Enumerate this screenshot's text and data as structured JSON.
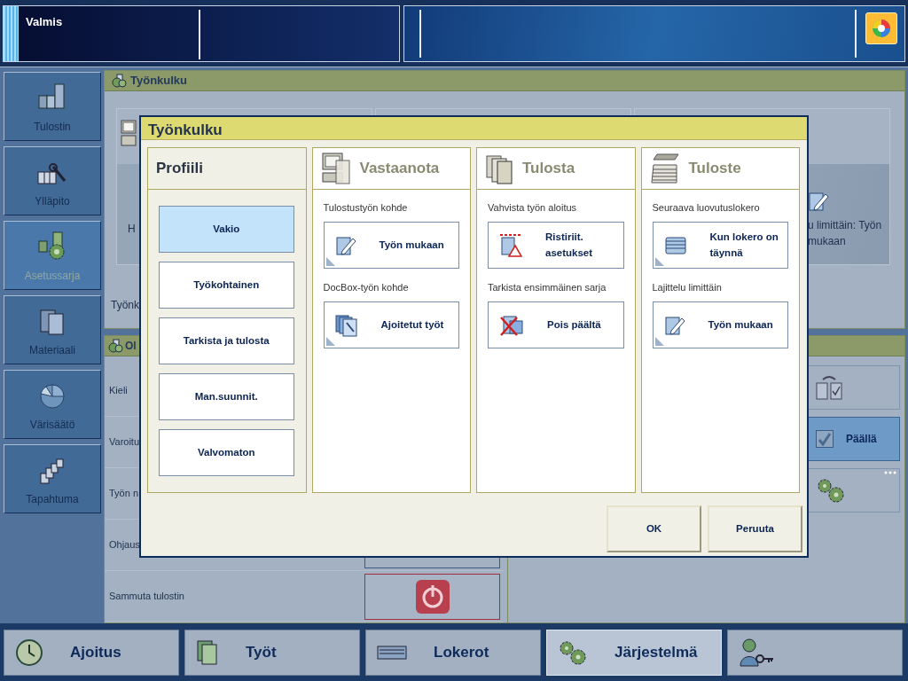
{
  "status_bar": {
    "status": "Valmis"
  },
  "sidebar": {
    "items": [
      {
        "label": "Tulostin",
        "selected": false
      },
      {
        "label": "Ylläpito",
        "selected": false
      },
      {
        "label": "Asetussarja",
        "selected": true
      },
      {
        "label": "Materiaali",
        "selected": false
      },
      {
        "label": "Värisäätö",
        "selected": false
      },
      {
        "label": "Tapahtuma",
        "selected": false
      }
    ]
  },
  "workflow_panel": {
    "title": "Työnkulku",
    "card_1_text": "H",
    "card_3_text": "u limittäin: Työn mukaan",
    "row_label": "Työnk"
  },
  "settings_panel": {
    "title": "Ol",
    "rows": [
      {
        "label": "Kieli",
        "kind": "plain"
      },
      {
        "label": "Varoitu",
        "kind": "plain"
      },
      {
        "label": "Työn n",
        "kind": "plain"
      },
      {
        "label": "Ohjaus",
        "kind": "field"
      },
      {
        "label": "Sammuta tulostin",
        "kind": "power"
      }
    ],
    "toggle": {
      "label": "Päällä",
      "checked": true
    }
  },
  "dialog": {
    "title": "Työnkulku",
    "profile": {
      "title": "Profiili",
      "options": [
        {
          "label": "Vakio",
          "selected": true
        },
        {
          "label": "Työkohtainen",
          "selected": false
        },
        {
          "label": "Tarkista ja tulosta",
          "selected": false
        },
        {
          "label": "Man.suunnit.",
          "selected": false
        },
        {
          "label": "Valvomaton",
          "selected": false
        }
      ]
    },
    "columns": [
      {
        "title": "Vastaanota",
        "settings": [
          {
            "label": "Tulostustyön kohde",
            "value": "Työn mukaan",
            "has_menu": true
          },
          {
            "label": "DocBox-työn kohde",
            "value": "Ajoitetut työt",
            "has_menu": true
          }
        ]
      },
      {
        "title": "Tulosta",
        "settings": [
          {
            "label": "Vahvista työn aloitus",
            "value": "Ristiriit. asetukset",
            "has_menu": false
          },
          {
            "label": "Tarkista ensimmäinen sarja",
            "value": "Pois päältä",
            "has_menu": false
          }
        ]
      },
      {
        "title": "Tuloste",
        "settings": [
          {
            "label": "Seuraava luovutuslokero",
            "value": "Kun lokero on täynnä",
            "has_menu": true
          },
          {
            "label": "Lajittelu limittäin",
            "value": "Työn mukaan",
            "has_menu": true
          }
        ]
      }
    ],
    "buttons": [
      "OK",
      "Peruuta"
    ]
  },
  "bottom_tabs": [
    {
      "label": "Ajoitus",
      "selected": false
    },
    {
      "label": "Työt",
      "selected": false
    },
    {
      "label": "Lokerot",
      "selected": false
    },
    {
      "label": "Järjestelmä",
      "selected": true
    }
  ]
}
